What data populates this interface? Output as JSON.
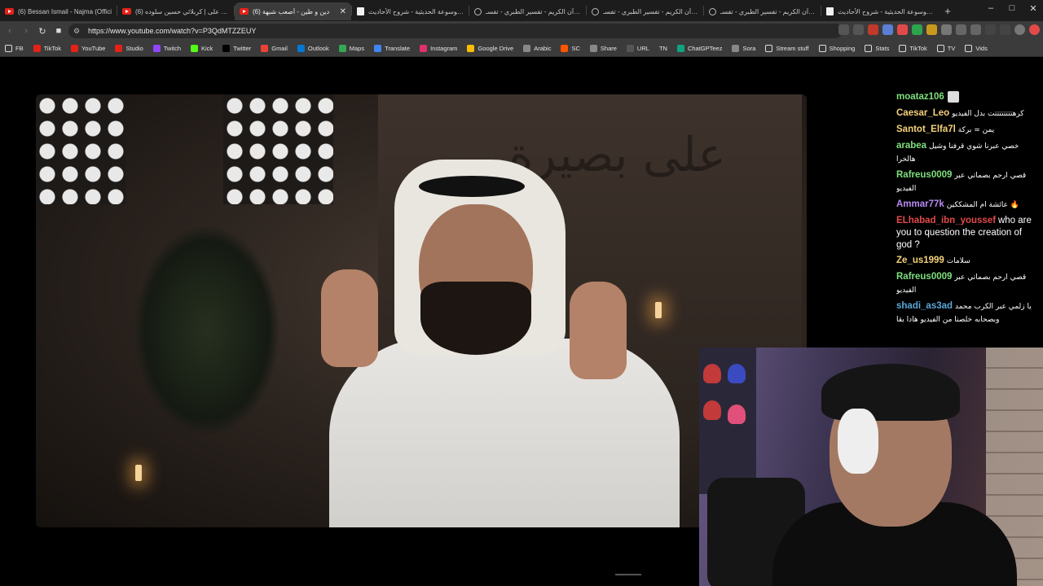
{
  "tabs": [
    {
      "title": "(6) Bessan Ismail - Najma (Offici",
      "icon": "youtube-icon"
    },
    {
      "title": "(6) تيار على | كربلائي حسين سلوده",
      "icon": "youtube-icon"
    },
    {
      "title": "(6) دين و طين - أصعب شبهة",
      "icon": "youtube-icon",
      "active": true
    },
    {
      "title": "الموسوعة الحديثية - شروح الأحاديث",
      "icon": "document-icon"
    },
    {
      "title": "القرآن الكريم - تفسير الطبري - تفسـ",
      "icon": "globe-icon"
    },
    {
      "title": "القرآن الكريم - تفسير الطبري - تفسـ",
      "icon": "globe-icon"
    },
    {
      "title": "القرآن الكريم - تفسير الطبري - تفسـ",
      "icon": "globe-icon"
    },
    {
      "title": "الموسوعة الحديثية - شروح الأحاديث",
      "icon": "document-icon"
    }
  ],
  "new_tab_label": "+",
  "window_controls": {
    "minimize": "–",
    "maximize": "□",
    "close": "✕"
  },
  "nav": {
    "back": "‹",
    "forward": "›",
    "reload": "↻",
    "bookmark": "■"
  },
  "address_bar": {
    "url": "https://www.youtube.com/watch?v=P3QdMTZZEUY",
    "site_icon": "⚙"
  },
  "bookmarks": [
    {
      "label": "FB",
      "icon": "folder-icon"
    },
    {
      "label": "TikTok",
      "icon": "youtube-icon",
      "color": "#e62117"
    },
    {
      "label": "YouTube",
      "icon": "youtube-icon",
      "color": "#e62117"
    },
    {
      "label": "Studio",
      "icon": "youtube-icon",
      "color": "#e62117"
    },
    {
      "label": "Twitch",
      "icon": "twitch-icon",
      "color": "#9146ff"
    },
    {
      "label": "Kick",
      "icon": "kick-icon",
      "color": "#53fc18"
    },
    {
      "label": "Twitter",
      "icon": "x-icon",
      "color": "#000000"
    },
    {
      "label": "Gmail",
      "icon": "gmail-icon",
      "color": "#ea4335"
    },
    {
      "label": "Outlook",
      "icon": "outlook-icon",
      "color": "#0078d4"
    },
    {
      "label": "Maps",
      "icon": "maps-icon",
      "color": "#34a853"
    },
    {
      "label": "Translate",
      "icon": "translate-icon",
      "color": "#4285f4"
    },
    {
      "label": "Instagram",
      "icon": "instagram-icon",
      "color": "#e1306c"
    },
    {
      "label": "Google Drive",
      "icon": "drive-icon",
      "color": "#fbbc04"
    },
    {
      "label": "Arabic",
      "icon": "globe-icon",
      "color": "#888888"
    },
    {
      "label": "SC",
      "icon": "sc-icon",
      "color": "#ff5500"
    },
    {
      "label": "Share",
      "icon": "globe-icon",
      "color": "#888888"
    },
    {
      "label": "URL",
      "icon": "url-icon",
      "color": "#555555"
    },
    {
      "label": "TN",
      "icon": "none",
      "color": "#3b3b3b"
    },
    {
      "label": "ChatGPTeez",
      "icon": "chatgpt-icon",
      "color": "#10a37f"
    },
    {
      "label": "Sora",
      "icon": "sora-icon",
      "color": "#888888"
    },
    {
      "label": "Stream stuff",
      "icon": "folder-icon"
    },
    {
      "label": "Shopping",
      "icon": "folder-icon"
    },
    {
      "label": "Stats",
      "icon": "folder-icon"
    },
    {
      "label": "TikTok",
      "icon": "folder-icon"
    },
    {
      "label": "TV",
      "icon": "folder-icon"
    },
    {
      "label": "Vids",
      "icon": "folder-icon"
    }
  ],
  "video": {
    "calligraphy": "على بصيرة"
  },
  "chat": {
    "messages": [
      {
        "user": "moataz106",
        "color": "#7ee07e",
        "text": "",
        "badge": true
      },
      {
        "user": "Caesar_Leo",
        "color": "#f5d37a",
        "text": "كرهتتتتتتتتت بدل الفيديو"
      },
      {
        "user": "Santot_Elfa7l",
        "color": "#f5d37a",
        "text": "يمن = بركة"
      },
      {
        "user": "arabea",
        "color": "#7ee07e",
        "text": "خصي عبرنا شوي قرفنا وشيل هالخرا"
      },
      {
        "user": "Rafreus0009",
        "color": "#7ee07e",
        "text": "قصي ارحم بصماتي عبر الفيديو"
      },
      {
        "user": "Ammar77k",
        "color": "#b98bf0",
        "text": "عائشة ام المشككين 🔥"
      },
      {
        "user": "ELhabad_ibn_youssef",
        "color": "#e24a4a",
        "text": "who are you to question the creation of god ?",
        "lang": "en"
      },
      {
        "user": "Ze_us1999",
        "color": "#f5d37a",
        "text": "سلامات"
      },
      {
        "user": "Rafreus0009",
        "color": "#7ee07e",
        "text": "قصي ارحم بصماتي عبر الفيديو"
      },
      {
        "user": "shadi_as3ad",
        "color": "#5aa8d8",
        "text": "يا زلمي عبر الكرب محمد وبصحابه خلصنا من الفيديو هادا بقا"
      }
    ]
  }
}
